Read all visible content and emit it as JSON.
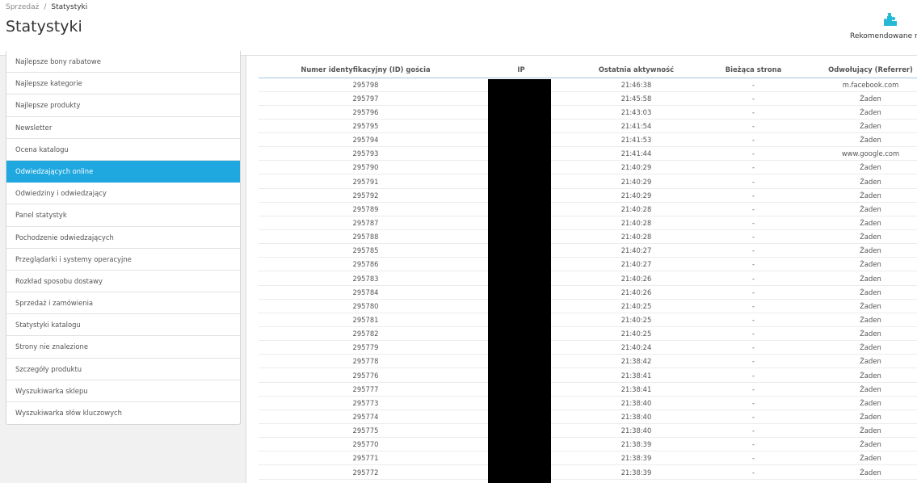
{
  "breadcrumb": {
    "parent": "Sprzedaż",
    "separator": "/",
    "current": "Statystyki"
  },
  "page_title": "Statystyki",
  "toolbar": {
    "recommended_label": "Rekomendowane mo",
    "icon": "puzzle-icon",
    "icon_color": "#25b9d7"
  },
  "sidebar": {
    "active_color": "#1fa7e0",
    "items": [
      {
        "label": "Najlepsze bony rabatowe"
      },
      {
        "label": "Najlepsze kategorie"
      },
      {
        "label": "Najlepsze produkty"
      },
      {
        "label": "Newsletter"
      },
      {
        "label": "Ocena katalogu"
      },
      {
        "label": "Odwiedzających online"
      },
      {
        "label": "Odwiedziny i odwiedzający"
      },
      {
        "label": "Panel statystyk"
      },
      {
        "label": "Pochodzenie odwiedzających"
      },
      {
        "label": "Przeglądarki i systemy operacyjne"
      },
      {
        "label": "Rozkład sposobu dostawy"
      },
      {
        "label": "Sprzedaż i zamówienia"
      },
      {
        "label": "Statystyki katalogu"
      },
      {
        "label": "Strony nie znalezione"
      },
      {
        "label": "Szczegóły produktu"
      },
      {
        "label": "Wyszukiwarka sklepu"
      },
      {
        "label": "Wyszukiwarka słów kluczowych"
      }
    ],
    "active_index": 5
  },
  "table": {
    "headers": [
      "Numer identyfikacyjny (ID) gościa",
      "IP",
      "Ostatnia aktywność",
      "Bieżąca strona",
      "Odwołujący (Referrer)"
    ],
    "rows": [
      [
        "295798",
        "",
        "21:46:38",
        "-",
        "m.facebook.com"
      ],
      [
        "295797",
        "",
        "21:45:58",
        "-",
        "Żaden"
      ],
      [
        "295796",
        "",
        "21:43:03",
        "-",
        "Żaden"
      ],
      [
        "295795",
        "",
        "21:41:54",
        "-",
        "Żaden"
      ],
      [
        "295794",
        "",
        "21:41:53",
        "-",
        "Żaden"
      ],
      [
        "295793",
        "",
        "21:41:44",
        "-",
        "www.google.com"
      ],
      [
        "295790",
        "",
        "21:40:29",
        "-",
        "Żaden"
      ],
      [
        "295791",
        "",
        "21:40:29",
        "-",
        "Żaden"
      ],
      [
        "295792",
        "",
        "21:40:29",
        "-",
        "Żaden"
      ],
      [
        "295789",
        "",
        "21:40:28",
        "-",
        "Żaden"
      ],
      [
        "295787",
        "",
        "21:40:28",
        "-",
        "Żaden"
      ],
      [
        "295788",
        "",
        "21:40:28",
        "-",
        "Żaden"
      ],
      [
        "295785",
        "",
        "21:40:27",
        "-",
        "Żaden"
      ],
      [
        "295786",
        "",
        "21:40:27",
        "-",
        "Żaden"
      ],
      [
        "295783",
        "",
        "21:40:26",
        "-",
        "Żaden"
      ],
      [
        "295784",
        "",
        "21:40:26",
        "-",
        "Żaden"
      ],
      [
        "295780",
        "",
        "21:40:25",
        "-",
        "Żaden"
      ],
      [
        "295781",
        "",
        "21:40:25",
        "-",
        "Żaden"
      ],
      [
        "295782",
        "",
        "21:40:25",
        "-",
        "Żaden"
      ],
      [
        "295779",
        "",
        "21:40:24",
        "-",
        "Żaden"
      ],
      [
        "295778",
        "",
        "21:38:42",
        "-",
        "Żaden"
      ],
      [
        "295776",
        "",
        "21:38:41",
        "-",
        "Żaden"
      ],
      [
        "295777",
        "",
        "21:38:41",
        "-",
        "Żaden"
      ],
      [
        "295773",
        "",
        "21:38:40",
        "-",
        "Żaden"
      ],
      [
        "295774",
        "",
        "21:38:40",
        "-",
        "Żaden"
      ],
      [
        "295775",
        "",
        "21:38:40",
        "-",
        "Żaden"
      ],
      [
        "295770",
        "",
        "21:38:39",
        "-",
        "Żaden"
      ],
      [
        "295771",
        "",
        "21:38:39",
        "-",
        "Żaden"
      ],
      [
        "295772",
        "",
        "21:38:39",
        "-",
        "Żaden"
      ]
    ]
  }
}
